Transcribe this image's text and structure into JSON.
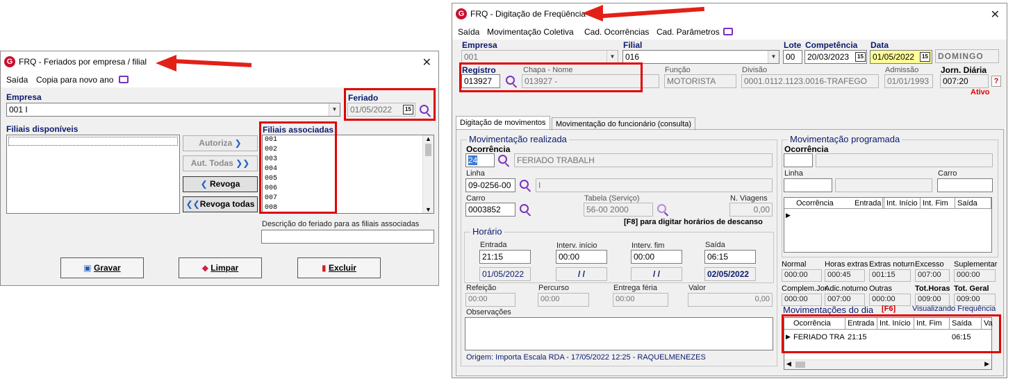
{
  "w1": {
    "title": "FRQ - Feriados por empresa / filial",
    "menu": [
      "Saída",
      "Copia para novo ano"
    ],
    "empresa_label": "Empresa",
    "empresa_value": "001 I",
    "feriado_label": "Feriado",
    "feriado_value": "01/05/2022",
    "cal_label": "15",
    "filiais_disp_label": "Filiais disponíveis",
    "filiais_assoc_label": "Filiais associadas",
    "filiais_assoc": [
      "001",
      "002",
      "003",
      "004",
      "005",
      "006",
      "007",
      "008"
    ],
    "btn_autoriza": "Autoriza",
    "btn_aut_todas": "Aut. Todas",
    "btn_revoga": "Revoga",
    "btn_revoga_todas": "Revoga todas",
    "descricao_label": "Descrição do feriado para as filiais associadas",
    "descricao_value": "",
    "btn_gravar": "Gravar",
    "btn_limpar": "Limpar",
    "btn_excluir": "Excluir"
  },
  "w2": {
    "title": "FRQ - Digitação de Freqüência",
    "menu": [
      "Saída",
      "Movimentação Coletiva",
      "Cad. Ocorrências",
      "Cad. Parâmetros"
    ],
    "empresa_label": "Empresa",
    "empresa_value": "001",
    "filial_label": "Filial",
    "filial_value": "016",
    "lote_label": "Lote",
    "lote_value": "00",
    "competencia_label": "Competência",
    "competencia_value": "20/03/2023",
    "data_label": "Data",
    "data_value": "01/05/2022",
    "dia_semana": "DOMINGO",
    "registro_label": "Registro",
    "registro_value": "013927",
    "chapa_label": "Chapa - Nome",
    "chapa_value": "013927 -",
    "funcao_label": "Função",
    "funcao_value": "MOTORISTA",
    "divisao_label": "Divisão",
    "divisao_value": "0001.0112.1123.0016-TRAFEGO",
    "admissao_label": "Admissão",
    "admissao_value": "01/01/1993",
    "jornada_label": "Jorn. Diária",
    "jornada_value": "007:20",
    "help": "?",
    "status": "Ativo",
    "tabs": [
      "Digitação de movimentos",
      "Movimentação do funcionário (consulta)"
    ],
    "mov_realizada": "Movimentação realizada",
    "ocorrencia_label": "Ocorrência",
    "ocorrencia_code": "24",
    "ocorrencia_desc": "FERIADO TRABALH",
    "linha_label": "Linha",
    "linha_value": "09-0256-00",
    "linha_desc": "I",
    "carro_label": "Carro",
    "carro_value": "0003852",
    "tabela_label": "Tabela (Serviço)",
    "tabela_value": "56-00 2000",
    "nviagens_label": "N. Viagens",
    "nviagens_value": "0,00",
    "f8_hint": "[F8] para digitar horários de descanso",
    "horario_label": "Horário",
    "entrada_label": "Entrada",
    "entrada_value": "21:15",
    "entrada_date": "01/05/2022",
    "interv_inicio_label": "Interv. início",
    "interv_inicio_value": "00:00",
    "interv_inicio_date": "/ /",
    "interv_fim_label": "Interv. fim",
    "interv_fim_value": "00:00",
    "interv_fim_date": "/ /",
    "saida_label": "Saída",
    "saida_value": "06:15",
    "saida_date": "02/05/2022",
    "refeicao_label": "Refeição",
    "refeicao_value": "00:00",
    "percurso_label": "Percurso",
    "percurso_value": "00:00",
    "entrega_label": "Entrega féria",
    "entrega_value": "00:00",
    "valor_label": "Valor",
    "valor_value": "0,00",
    "observacoes_label": "Observações",
    "origem": "Origem: Importa Escala RDA - 17/05/2022 12:25 - RAQUELMENEZES",
    "mov_programada": "Movimentação programada",
    "prog_ocorrencia_label": "Ocorrência",
    "prog_linha_label": "Linha",
    "prog_carro_label": "Carro",
    "prog_cols": [
      "Ocorrência",
      "Entrada",
      "Int. Início",
      "Int. Fim",
      "Saída"
    ],
    "totals_row1_labels": [
      "Normal",
      "Horas extras",
      "Extras noturn",
      "Excesso",
      "Suplementar"
    ],
    "totals_row1_values": [
      "000:00",
      "000:45",
      "001:15",
      "007:00",
      "000:00"
    ],
    "totals_row2_labels": [
      "Complem.Jor.",
      "Adic.noturno",
      "Outras",
      "Tot.Horas",
      "Tot. Geral"
    ],
    "totals_row2_values": [
      "000:00",
      "007:00",
      "000:00",
      "009:00",
      "009:00"
    ],
    "mov_dia_label": "Movimentações do dia",
    "f6": "[F6]",
    "visualizando": "Visualizando Frequência",
    "dia_cols": [
      "Ocorrência",
      "Entrada",
      "Int. Início",
      "Int. Fim",
      "Saída",
      "Va"
    ],
    "dia_row": [
      "FERIADO TRA",
      "21:15",
      "",
      "",
      "06:15",
      ""
    ]
  }
}
